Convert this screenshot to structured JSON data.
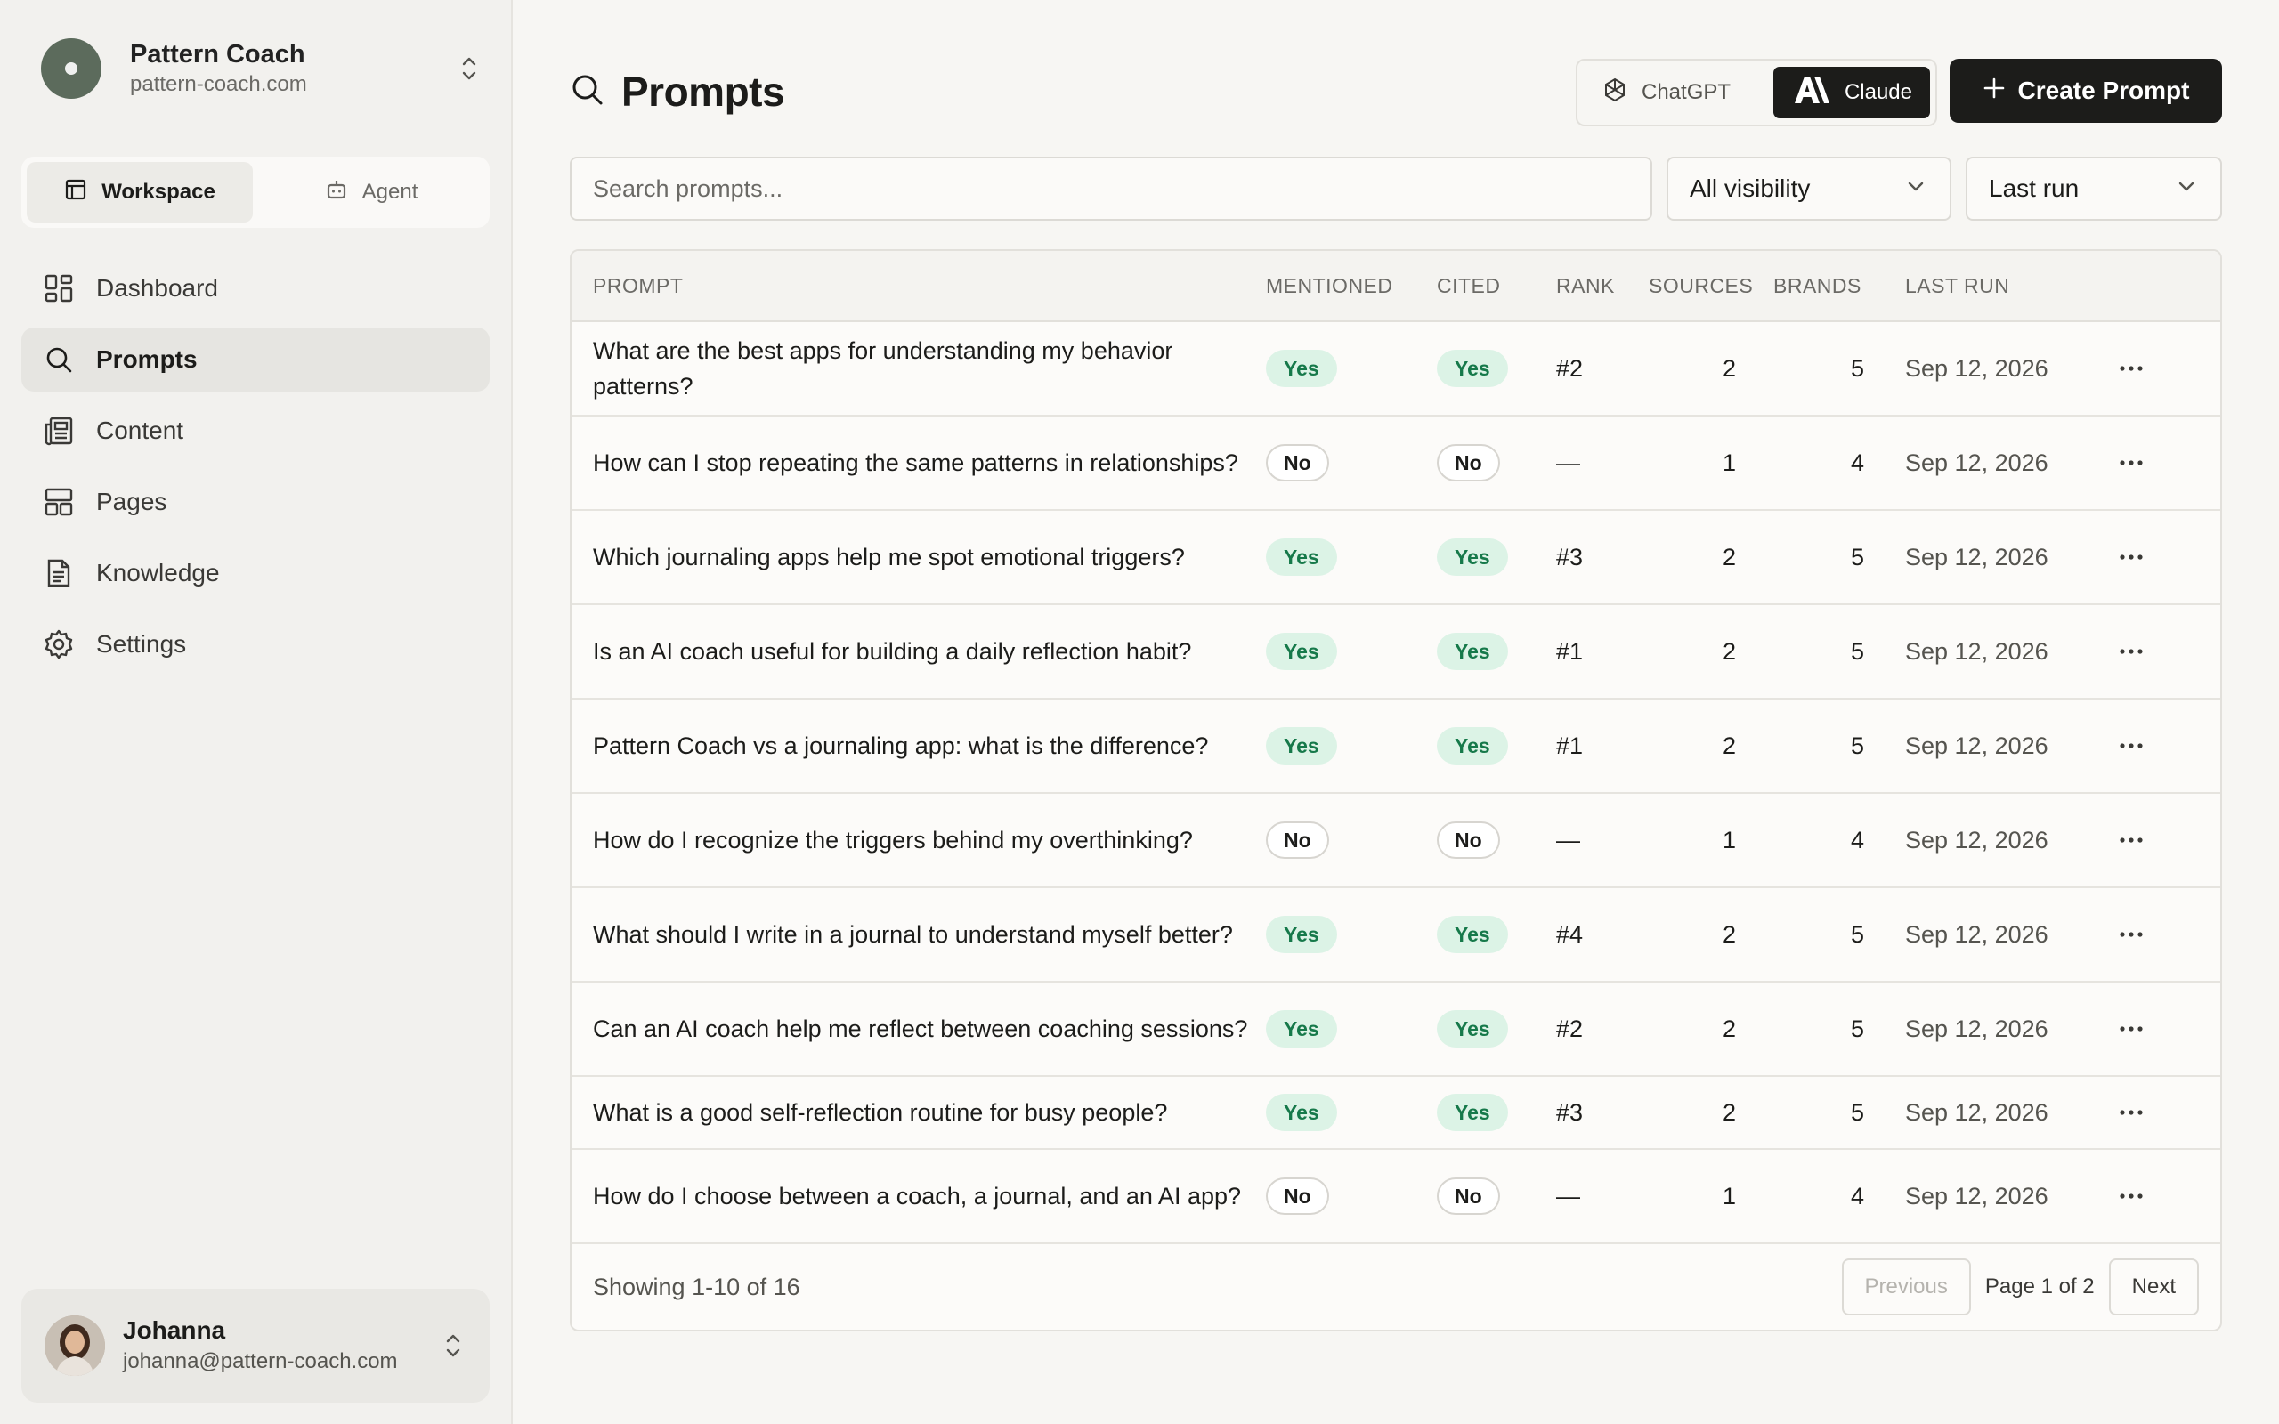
{
  "org": {
    "name": "Pattern Coach",
    "domain": "pattern-coach.com"
  },
  "mode": {
    "workspace": "Workspace",
    "agent": "Agent"
  },
  "nav": [
    "Dashboard",
    "Prompts",
    "Content",
    "Pages",
    "Knowledge",
    "Settings"
  ],
  "user": {
    "name": "Johanna",
    "email": "johanna@pattern-coach.com"
  },
  "header": {
    "title": "Prompts",
    "model_chatgpt": "ChatGPT",
    "model_claude": "Claude",
    "create": "Create Prompt"
  },
  "filters": {
    "search_placeholder": "Search prompts...",
    "visibility": "All visibility",
    "sort": "Last run"
  },
  "table": {
    "columns": [
      "PROMPT",
      "MENTIONED",
      "CITED",
      "RANK",
      "SOURCES",
      "BRANDS",
      "LAST RUN"
    ],
    "rows": [
      {
        "prompt": "What are the best apps for understanding my behavior patterns?",
        "mentioned": "Yes",
        "cited": "Yes",
        "rank": "#2",
        "sources": "2",
        "brands": "5",
        "last_run": "Sep 12, 2026"
      },
      {
        "prompt": "How can I stop repeating the same patterns in relationships?",
        "mentioned": "No",
        "cited": "No",
        "rank": "—",
        "sources": "1",
        "brands": "4",
        "last_run": "Sep 12, 2026"
      },
      {
        "prompt": "Which journaling apps help me spot emotional triggers?",
        "mentioned": "Yes",
        "cited": "Yes",
        "rank": "#3",
        "sources": "2",
        "brands": "5",
        "last_run": "Sep 12, 2026"
      },
      {
        "prompt": "Is an AI coach useful for building a daily reflection habit?",
        "mentioned": "Yes",
        "cited": "Yes",
        "rank": "#1",
        "sources": "2",
        "brands": "5",
        "last_run": "Sep 12, 2026"
      },
      {
        "prompt": "Pattern Coach vs a journaling app: what is the difference?",
        "mentioned": "Yes",
        "cited": "Yes",
        "rank": "#1",
        "sources": "2",
        "brands": "5",
        "last_run": "Sep 12, 2026"
      },
      {
        "prompt": "How do I recognize the triggers behind my overthinking?",
        "mentioned": "No",
        "cited": "No",
        "rank": "—",
        "sources": "1",
        "brands": "4",
        "last_run": "Sep 12, 2026"
      },
      {
        "prompt": "What should I write in a journal to understand myself better?",
        "mentioned": "Yes",
        "cited": "Yes",
        "rank": "#4",
        "sources": "2",
        "brands": "5",
        "last_run": "Sep 12, 2026"
      },
      {
        "prompt": "Can an AI coach help me reflect between coaching sessions?",
        "mentioned": "Yes",
        "cited": "Yes",
        "rank": "#2",
        "sources": "2",
        "brands": "5",
        "last_run": "Sep 12, 2026"
      },
      {
        "prompt": "What is a good self-reflection routine for busy people?",
        "mentioned": "Yes",
        "cited": "Yes",
        "rank": "#3",
        "sources": "2",
        "brands": "5",
        "last_run": "Sep 12, 2026"
      },
      {
        "prompt": "How do I choose between a coach, a journal, and an AI app?",
        "mentioned": "No",
        "cited": "No",
        "rank": "—",
        "sources": "1",
        "brands": "4",
        "last_run": "Sep 12, 2026"
      }
    ]
  },
  "footer": {
    "showing": "Showing 1-10 of 16",
    "previous": "Previous",
    "page": "Page 1 of 2",
    "next": "Next"
  },
  "colors": {
    "accent": "#1c1c1a",
    "yes_bg": "#dcf3e6",
    "yes_text": "#16794a",
    "org_avatar": "#5c6b5c"
  },
  "icons": [
    "chevron-updown-icon",
    "workspace-icon",
    "agent-icon",
    "dashboard-icon",
    "search-icon",
    "content-icon",
    "pages-icon",
    "knowledge-icon",
    "settings-icon",
    "openai-icon",
    "anthropic-icon",
    "plus-icon",
    "chevron-down-icon",
    "more-icon"
  ]
}
